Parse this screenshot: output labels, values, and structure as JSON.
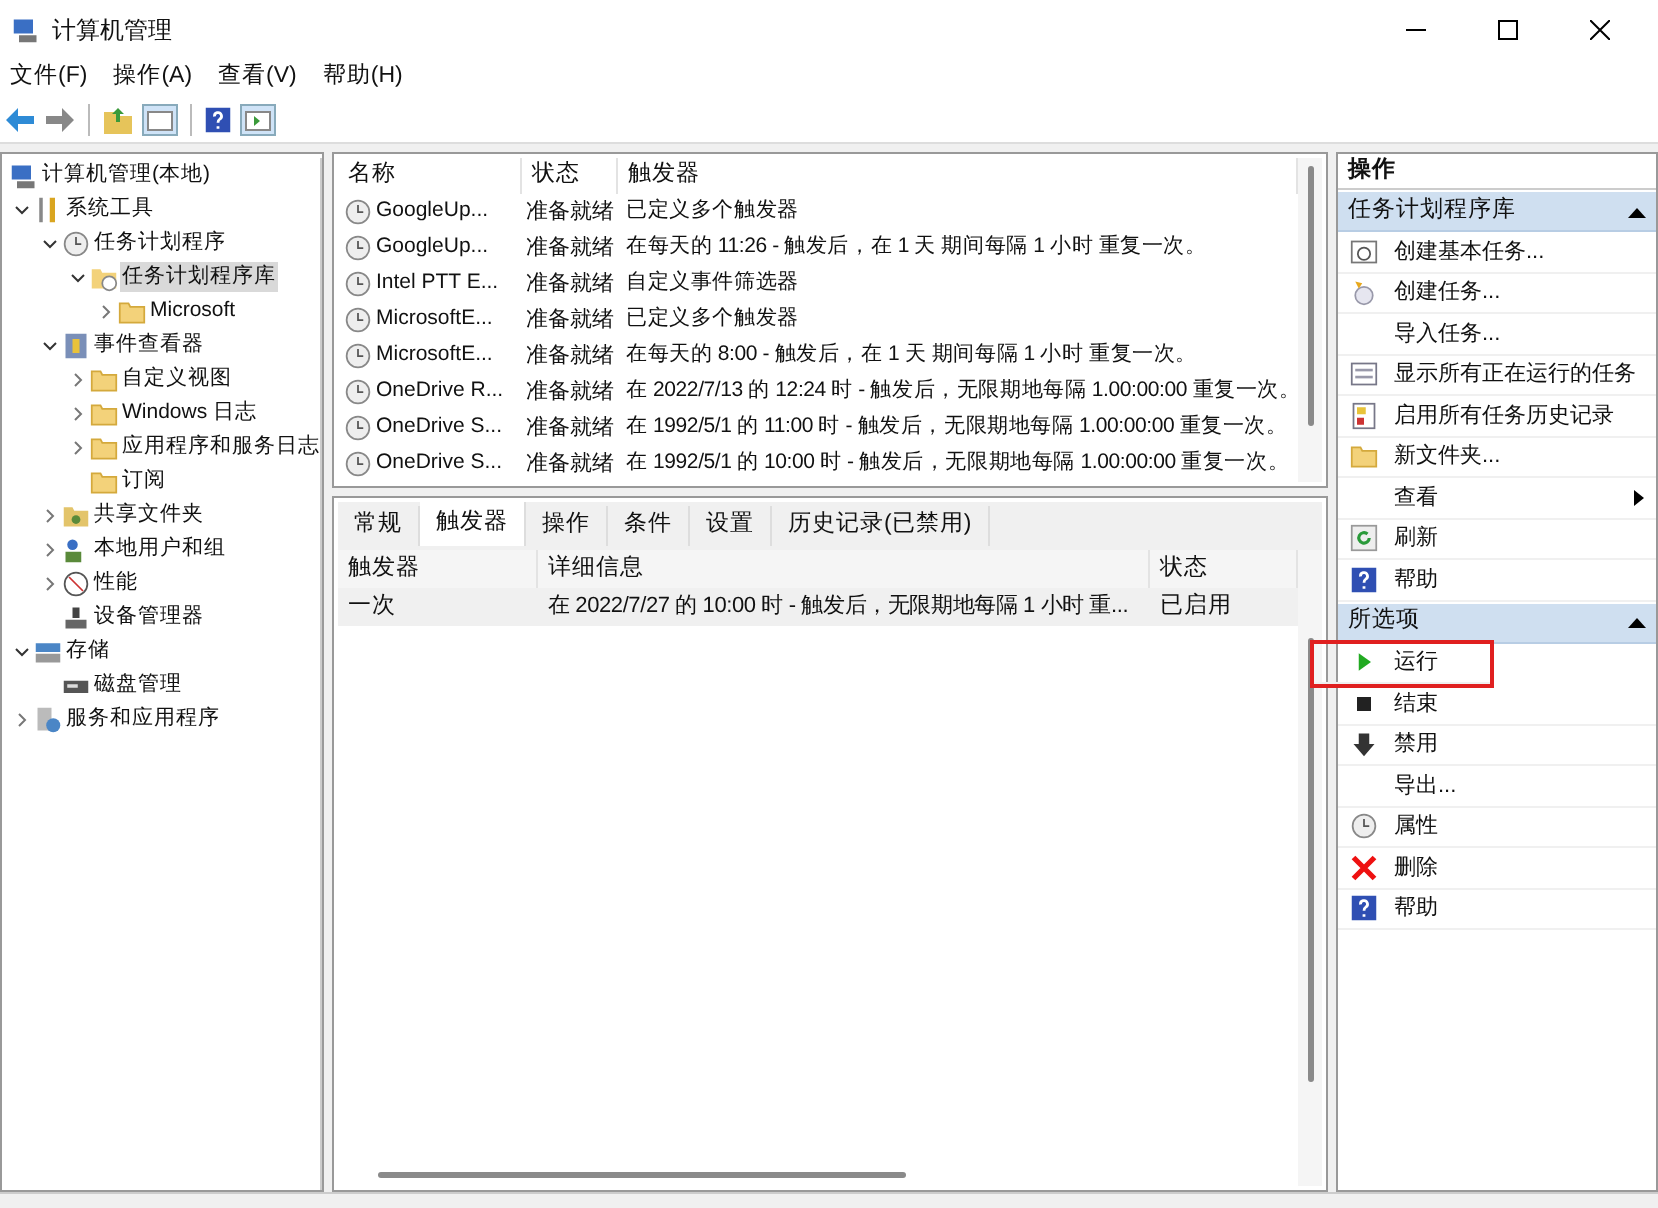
{
  "window": {
    "title": "计算机管理"
  },
  "menu": [
    "文件(F)",
    "操作(A)",
    "查看(V)",
    "帮助(H)"
  ],
  "tree": [
    {
      "label": "计算机管理(本地)",
      "kind": "computer",
      "selected": false,
      "children": [
        {
          "label": "系统工具",
          "kind": "tools",
          "expanded": true,
          "selected": false,
          "children": [
            {
              "label": "任务计划程序",
              "kind": "clock",
              "expanded": true,
              "selected": false,
              "children": [
                {
                  "label": "任务计划程序库",
                  "kind": "taskfolder",
                  "expanded": true,
                  "selected": true,
                  "children": [
                    {
                      "label": "Microsoft",
                      "kind": "folder",
                      "expanded": false,
                      "selected": false
                    }
                  ]
                }
              ]
            },
            {
              "label": "事件查看器",
              "kind": "events",
              "expanded": true,
              "selected": false,
              "children": [
                {
                  "label": "自定义视图",
                  "kind": "folder",
                  "expanded": false,
                  "selected": false
                },
                {
                  "label": "Windows 日志",
                  "kind": "folder",
                  "expanded": false,
                  "selected": false
                },
                {
                  "label": "应用程序和服务日志",
                  "kind": "folder",
                  "expanded": false,
                  "selected": false
                },
                {
                  "label": "订阅",
                  "kind": "folder",
                  "selected": false
                }
              ]
            },
            {
              "label": "共享文件夹",
              "kind": "share",
              "expanded": false,
              "selected": false
            },
            {
              "label": "本地用户和组",
              "kind": "users",
              "expanded": false,
              "selected": false
            },
            {
              "label": "性能",
              "kind": "perf",
              "expanded": false,
              "selected": false
            },
            {
              "label": "设备管理器",
              "kind": "device",
              "selected": false
            }
          ]
        },
        {
          "label": "存储",
          "kind": "storage",
          "expanded": true,
          "selected": false,
          "children": [
            {
              "label": "磁盘管理",
              "kind": "disk",
              "selected": false
            }
          ]
        },
        {
          "label": "服务和应用程序",
          "kind": "services",
          "expanded": false,
          "selected": false
        }
      ]
    }
  ],
  "task_list": {
    "columns": [
      "名称",
      "状态",
      "触发器"
    ],
    "rows": [
      {
        "name": "GoogleUp...",
        "status": "准备就绪",
        "trigger": "已定义多个触发器"
      },
      {
        "name": "GoogleUp...",
        "status": "准备就绪",
        "trigger": "在每天的 11:26 - 触发后，在 1 天 期间每隔 1 小时 重复一次。"
      },
      {
        "name": "Intel PTT E...",
        "status": "准备就绪",
        "trigger": "自定义事件筛选器"
      },
      {
        "name": "MicrosoftE...",
        "status": "准备就绪",
        "trigger": "已定义多个触发器"
      },
      {
        "name": "MicrosoftE...",
        "status": "准备就绪",
        "trigger": "在每天的 8:00 - 触发后，在 1 天 期间每隔 1 小时 重复一次。"
      },
      {
        "name": "OneDrive R...",
        "status": "准备就绪",
        "trigger": "在 2022/7/13 的 12:24 时 - 触发后，无限期地每隔 1.00:00:00 重复一次。"
      },
      {
        "name": "OneDrive S...",
        "status": "准备就绪",
        "trigger": "在 1992/5/1 的 11:00 时 - 触发后，无限期地每隔 1.00:00:00 重复一次。"
      },
      {
        "name": "OneDrive S...",
        "status": "准备就绪",
        "trigger": "在 1992/5/1 的 10:00 时 - 触发后，无限期地每隔 1.00:00:00 重复一次。"
      }
    ]
  },
  "tabs": [
    {
      "label": "常规",
      "selected": false
    },
    {
      "label": "触发器",
      "selected": true
    },
    {
      "label": "操作",
      "selected": false
    },
    {
      "label": "条件",
      "selected": false
    },
    {
      "label": "设置",
      "selected": false
    },
    {
      "label": "历史记录(已禁用)",
      "selected": false
    }
  ],
  "trigger_table": {
    "columns": [
      "触发器",
      "详细信息",
      "状态"
    ],
    "rows": [
      {
        "trigger": "一次",
        "details": "在 2022/7/27 的 10:00 时 - 触发后，无限期地每隔 1 小时 重...",
        "status": "已启用"
      }
    ]
  },
  "actions": {
    "title": "操作",
    "sections": [
      {
        "title": "任务计划程序库",
        "expanded": true,
        "items": [
          {
            "label": "创建基本任务...",
            "kind": "calendar"
          },
          {
            "label": "创建任务...",
            "kind": "task"
          },
          {
            "label": "导入任务...",
            "kind": "none"
          },
          {
            "label": "显示所有正在运行的任务",
            "kind": "list"
          },
          {
            "label": "启用所有任务历史记录",
            "kind": "log"
          },
          {
            "label": "新文件夹...",
            "kind": "folder"
          },
          {
            "label": "查看",
            "kind": "submenu"
          },
          {
            "label": "刷新",
            "kind": "refresh"
          },
          {
            "label": "帮助",
            "kind": "help"
          }
        ]
      },
      {
        "title": "所选项",
        "expanded": true,
        "items": [
          {
            "label": "运行",
            "kind": "play",
            "highlighted": true
          },
          {
            "label": "结束",
            "kind": "stop"
          },
          {
            "label": "禁用",
            "kind": "disable"
          },
          {
            "label": "导出...",
            "kind": "none"
          },
          {
            "label": "属性",
            "kind": "clock"
          },
          {
            "label": "删除",
            "kind": "delete"
          },
          {
            "label": "帮助",
            "kind": "help"
          }
        ]
      }
    ]
  }
}
